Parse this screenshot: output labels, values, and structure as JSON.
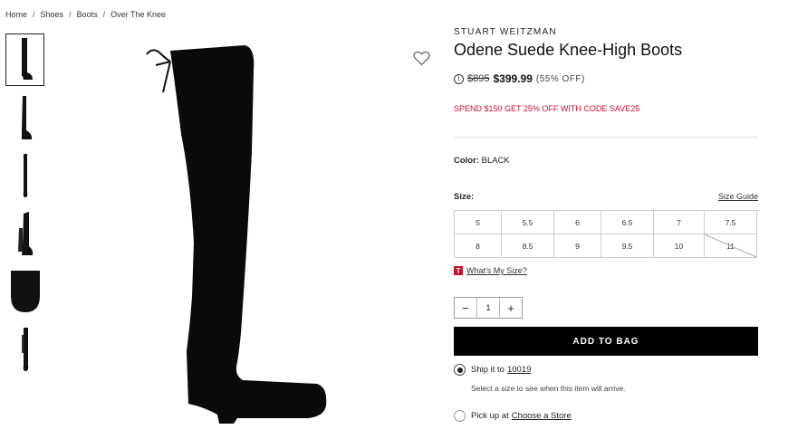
{
  "breadcrumb": [
    "Home",
    "Shoes",
    "Boots",
    "Over The Knee"
  ],
  "product": {
    "brand": "STUART WEITZMAN",
    "title": "Odene Suede Knee-High Boots",
    "old_price": "$895",
    "new_price": "$399.99",
    "discount": "(55% OFF)",
    "promo": "SPEND $150 GET 25% OFF WITH CODE SAVE25",
    "color_label": "Color:",
    "color_value": "BLACK"
  },
  "size": {
    "label": "Size:",
    "guide": "Size Guide",
    "options": [
      "5",
      "5.5",
      "6",
      "6.5",
      "7",
      "7.5",
      "8",
      "8.5",
      "9",
      "9.5",
      "10",
      "11"
    ],
    "unavailable": [
      "11"
    ],
    "whats_my_size_badge": "T",
    "whats_my_size": "What's My Size?"
  },
  "quantity": {
    "minus": "−",
    "value": "1",
    "plus": "+"
  },
  "add_to_bag": "ADD TO BAG",
  "shipping": {
    "ship_label": "Ship it to",
    "zip": "10019",
    "note": "Select a size to see when this item will arrive.",
    "pickup_label": "Pick up at",
    "pickup_link": "Choose a Store"
  },
  "icons": {
    "info": "info-icon",
    "heart": "heart-icon",
    "radio_selected": "radio-selected",
    "radio": "radio-empty"
  },
  "colors": {
    "accent_red": "#c8102e",
    "button_black": "#000000"
  }
}
